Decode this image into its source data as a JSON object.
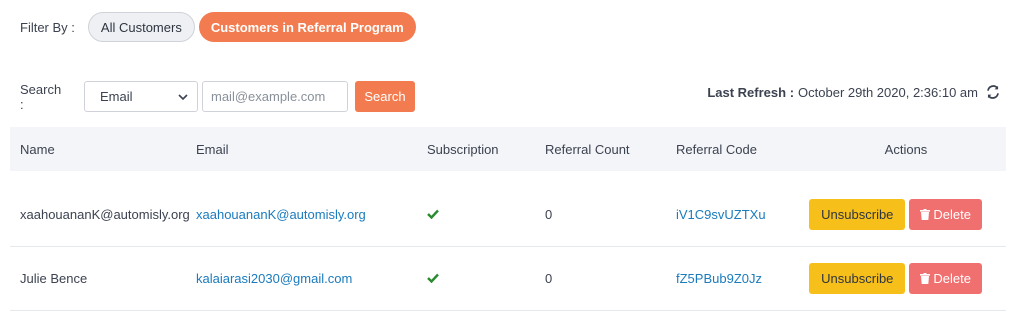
{
  "filter": {
    "label": "Filter By :",
    "options": [
      "All Customers",
      "Customers in Referral Program"
    ],
    "active": "Customers in Referral Program"
  },
  "search": {
    "label": "Search :",
    "field_select": "Email",
    "placeholder": "mail@example.com",
    "button": "Search"
  },
  "refresh": {
    "label": "Last Refresh :",
    "value": "October 29th 2020, 2:36:10 am",
    "icon": "refresh-icon"
  },
  "table": {
    "headers": [
      "Name",
      "Email",
      "Subscription",
      "Referral Count",
      "Referral Code",
      "Actions"
    ],
    "rows": [
      {
        "name": "xaahouananK@automisly.org",
        "email": "xaahouananK@automisly.org",
        "subscription": "check-icon",
        "referral_count": "0",
        "referral_code": "iV1C9svUZTXu",
        "unsubscribe": "Unsubscribe",
        "delete": "Delete"
      },
      {
        "name": "Julie Bence",
        "email": "kalaiarasi2030@gmail.com",
        "subscription": "check-icon",
        "referral_count": "0",
        "referral_code": "fZ5PBub9Z0Jz",
        "unsubscribe": "Unsubscribe",
        "delete": "Delete"
      }
    ]
  },
  "colors": {
    "accent": "#f27c4f",
    "link": "#1a7bbd",
    "check": "#2a8a2e",
    "unsubscribe": "#f6bf1a",
    "delete": "#f07070",
    "header_bg": "#f3f5f8"
  }
}
